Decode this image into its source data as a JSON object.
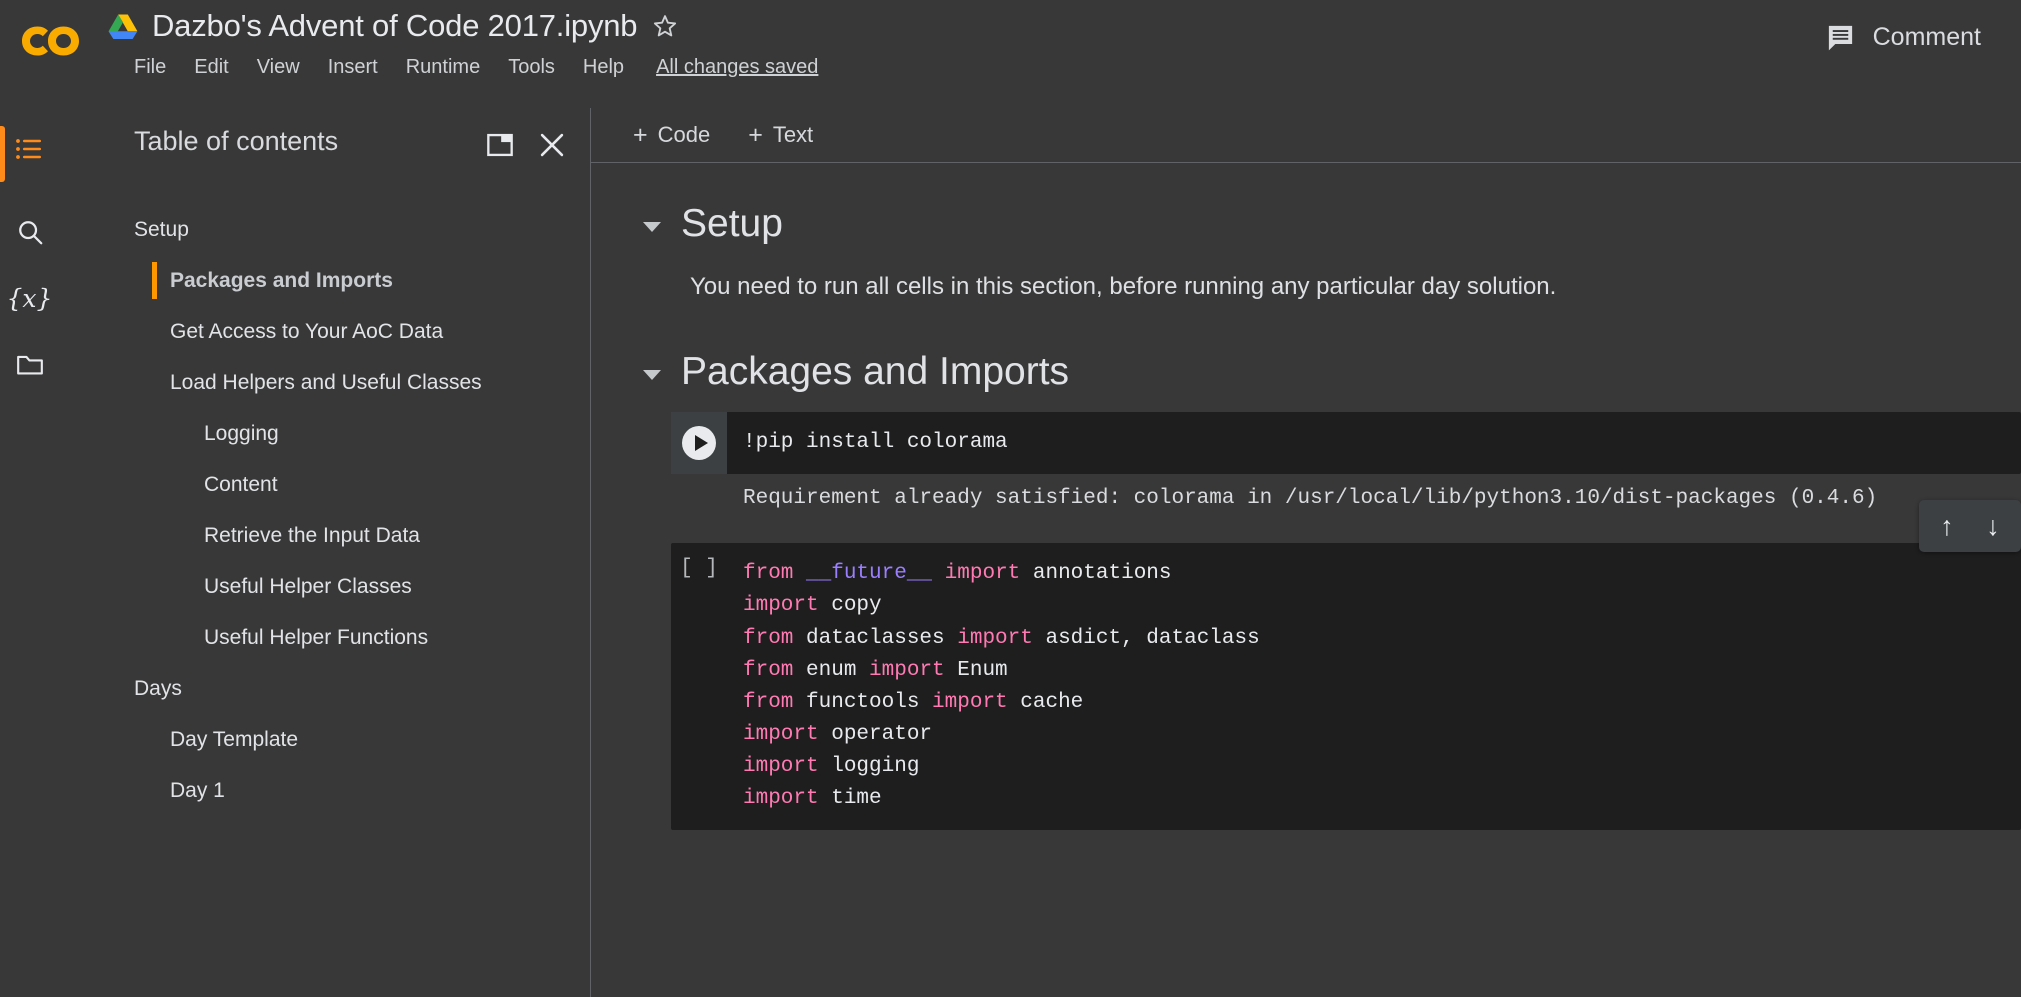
{
  "header": {
    "logo": "colab-logo",
    "drive_icon": "google-drive-icon",
    "doc_title": "Dazbo's Advent of Code 2017.ipynb",
    "star_icon": "star-outline-icon",
    "menus": [
      "File",
      "Edit",
      "View",
      "Insert",
      "Runtime",
      "Tools",
      "Help"
    ],
    "save_status": "All changes saved",
    "comment_icon": "comment-icon",
    "comment_label": "Comment"
  },
  "rail": {
    "items": [
      {
        "name": "toc-icon",
        "glyph": "list"
      },
      {
        "name": "search-icon",
        "glyph": "magnifier"
      },
      {
        "name": "variables-icon",
        "glyph": "{x}"
      },
      {
        "name": "files-icon",
        "glyph": "folder"
      }
    ]
  },
  "toc": {
    "title": "Table of contents",
    "popout_icon": "panel-popout-icon",
    "close_icon": "close-icon",
    "items": [
      {
        "label": "Setup",
        "level": 1,
        "active": false
      },
      {
        "label": "Packages and Imports",
        "level": 2,
        "active": true
      },
      {
        "label": "Get Access to Your AoC Data",
        "level": 2,
        "active": false
      },
      {
        "label": "Load Helpers and Useful Classes",
        "level": 2,
        "active": false
      },
      {
        "label": "Logging",
        "level": 3,
        "active": false
      },
      {
        "label": "Content",
        "level": 3,
        "active": false
      },
      {
        "label": "Retrieve the Input Data",
        "level": 3,
        "active": false
      },
      {
        "label": "Useful Helper Classes",
        "level": 3,
        "active": false
      },
      {
        "label": "Useful Helper Functions",
        "level": 3,
        "active": false
      },
      {
        "label": "Days",
        "level": 1,
        "active": false
      },
      {
        "label": "Day Template",
        "level": 2,
        "active": false
      },
      {
        "label": "Day 1",
        "level": 2,
        "active": false
      }
    ]
  },
  "toolbar": {
    "add_code_label": "Code",
    "add_text_label": "Text",
    "plus": "+"
  },
  "notebook": {
    "setup_heading": "Setup",
    "setup_paragraph": "You need to run all cells in this section, before running any particular day solution.",
    "packages_heading": "Packages and Imports",
    "pip_cell": {
      "run_icon": "run-cell-icon",
      "code": "!pip install colorama",
      "output": "Requirement already satisfied: colorama in /usr/local/lib/python3.10/dist-packages (0.4.6)"
    },
    "import_cell": {
      "prompt": "[ ]",
      "lines": [
        [
          {
            "t": "from ",
            "c": "kw"
          },
          {
            "t": "__future__",
            "c": "mod"
          },
          {
            "t": " ",
            "c": "id"
          },
          {
            "t": "import ",
            "c": "kw"
          },
          {
            "t": "annotations",
            "c": "id"
          }
        ],
        [
          {
            "t": "import ",
            "c": "kw"
          },
          {
            "t": "copy",
            "c": "id"
          }
        ],
        [
          {
            "t": "from ",
            "c": "kw"
          },
          {
            "t": "dataclasses ",
            "c": "id"
          },
          {
            "t": "import ",
            "c": "kw"
          },
          {
            "t": "asdict, dataclass",
            "c": "id"
          }
        ],
        [
          {
            "t": "from ",
            "c": "kw"
          },
          {
            "t": "enum ",
            "c": "id"
          },
          {
            "t": "import ",
            "c": "kw"
          },
          {
            "t": "Enum",
            "c": "id"
          }
        ],
        [
          {
            "t": "from ",
            "c": "kw"
          },
          {
            "t": "functools ",
            "c": "id"
          },
          {
            "t": "import ",
            "c": "kw"
          },
          {
            "t": "cache",
            "c": "id"
          }
        ],
        [
          {
            "t": "import ",
            "c": "kw"
          },
          {
            "t": "operator",
            "c": "id"
          }
        ],
        [
          {
            "t": "import ",
            "c": "kw"
          },
          {
            "t": "logging",
            "c": "id"
          }
        ],
        [
          {
            "t": "import ",
            "c": "kw"
          },
          {
            "t": "time",
            "c": "id"
          }
        ]
      ]
    }
  },
  "float_tools": {
    "move_up_icon": "arrow-up-icon",
    "move_up_glyph": "↑",
    "move_down_icon": "arrow-down-icon",
    "move_down_glyph": "↓"
  },
  "colors": {
    "bg": "#383838",
    "code_bg": "#1e1e1e",
    "accent_orange": "#ff9800",
    "keyword_pink": "#ff7ab2",
    "module_purple": "#9a7fff",
    "text": "#e8eaed"
  }
}
